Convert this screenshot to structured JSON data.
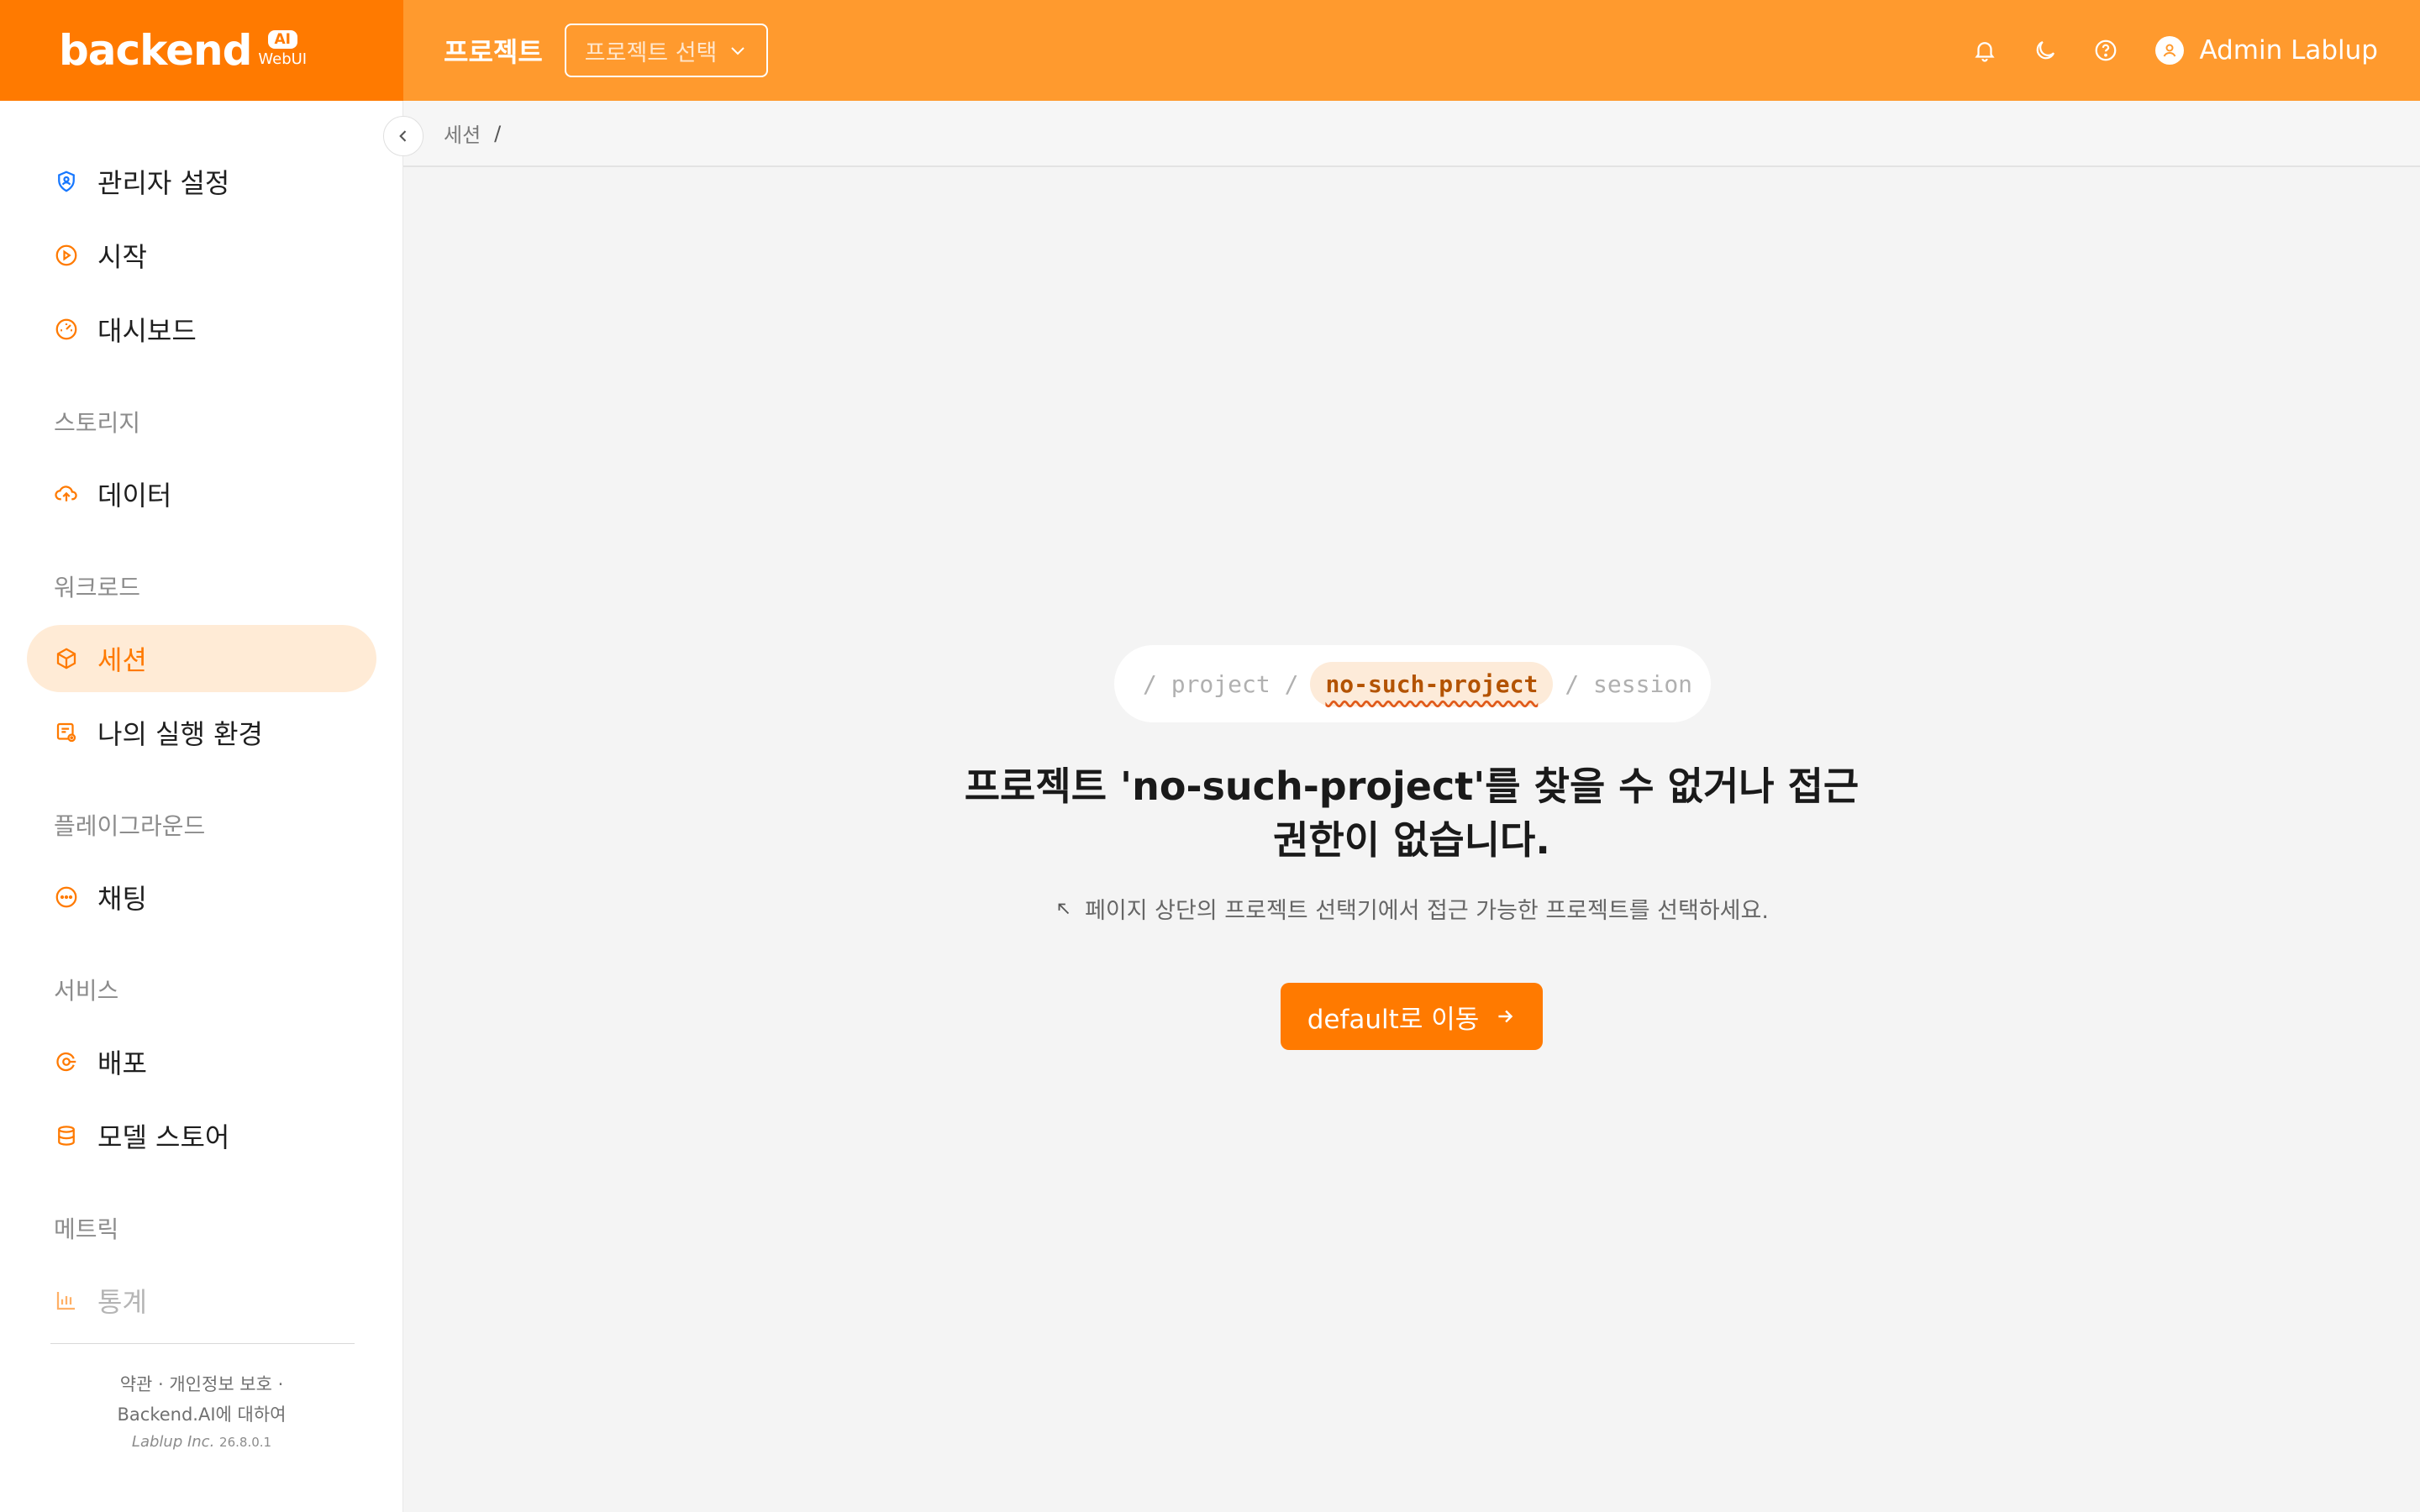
{
  "header": {
    "logo_text": "backend",
    "logo_ai": "AI",
    "logo_webui": "WebUI",
    "title": "프로젝트",
    "project_select_placeholder": "프로젝트 선택",
    "user_name": "Admin Lablup",
    "icons": [
      "bell-icon",
      "moon-icon",
      "help-icon",
      "user-icon"
    ]
  },
  "sidebar": {
    "items": [
      {
        "label": "관리자 설정",
        "icon": "shield-user-icon"
      },
      {
        "label": "시작",
        "icon": "play-circle-icon"
      },
      {
        "label": "대시보드",
        "icon": "dashboard-icon"
      },
      {
        "label": "데이터",
        "icon": "cloud-upload-icon"
      },
      {
        "label": "세션",
        "icon": "cube-icon",
        "active": true
      },
      {
        "label": "나의 실행 환경",
        "icon": "environment-icon"
      },
      {
        "label": "채팅",
        "icon": "chat-icon"
      },
      {
        "label": "배포",
        "icon": "deploy-icon"
      },
      {
        "label": "모델 스토어",
        "icon": "database-icon"
      },
      {
        "label": "통계",
        "icon": "bar-chart-icon",
        "disabled": true
      }
    ],
    "groups": [
      "스토리지",
      "워크로드",
      "플레이그라운드",
      "서비스",
      "메트릭"
    ],
    "footer": {
      "line1": "약관 · 개인정보 보호 ·",
      "line2": "Backend.AI에 대하여",
      "company": "Lablup Inc.",
      "version": "26.8.0.1"
    }
  },
  "breadcrumb": {
    "current": "세션",
    "separator": "/"
  },
  "main": {
    "path": {
      "prefix": "/ project /",
      "highlight": "no-such-project",
      "suffix": "/ session"
    },
    "error_line1": "프로젝트 'no-such-project'를 찾을 수 없거나 접근",
    "error_line2": "권한이 없습니다.",
    "hint": "페이지 상단의 프로젝트 선택기에서 접근 가능한 프로젝트를 선택하세요.",
    "button_label": "default로 이동"
  },
  "colors": {
    "primary": "#ff7a00",
    "header": "#ff9a2e",
    "active_bg": "#ffebd6"
  }
}
